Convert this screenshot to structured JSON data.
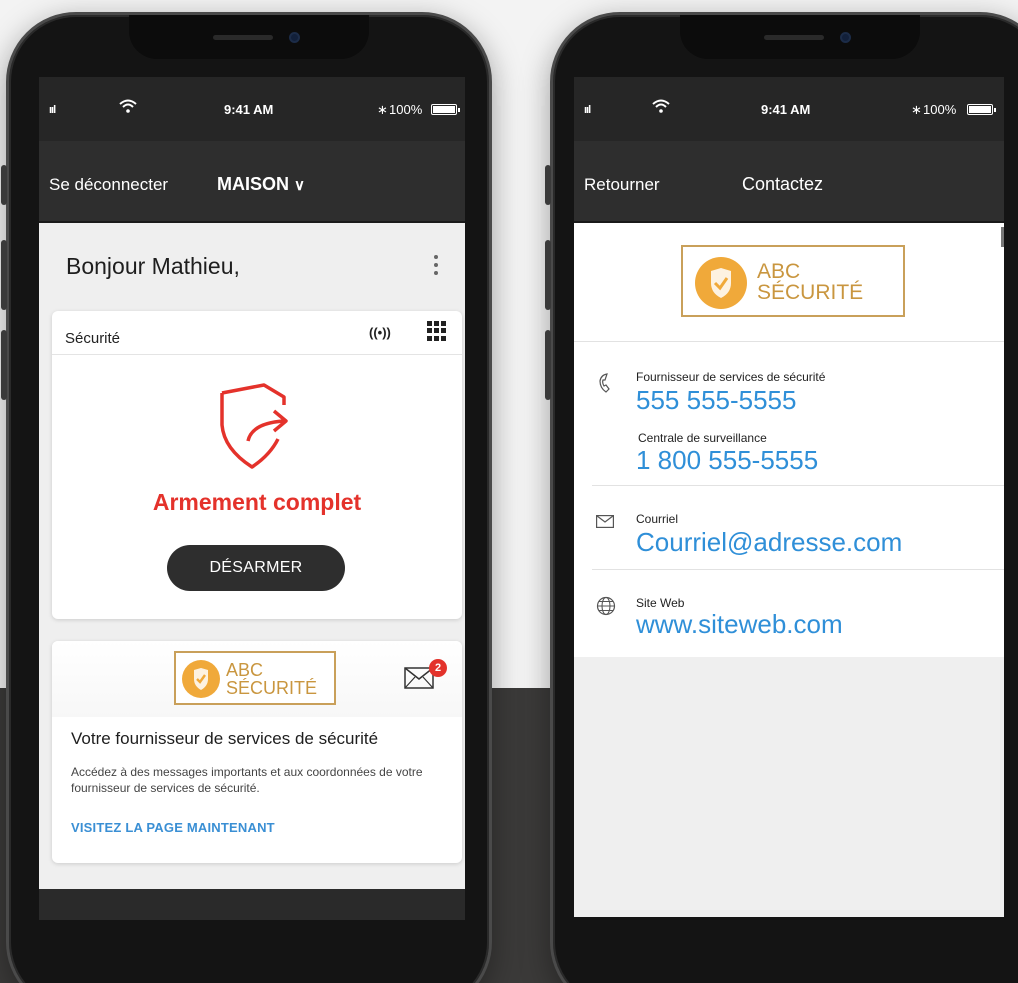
{
  "colors": {
    "accent_red": "#e4322b",
    "link_blue": "#2f8fd8",
    "logo_gold": "#c9a05a",
    "nav_dark": "#2e2e2e"
  },
  "left_phone": {
    "status": {
      "signal": "ııl",
      "wifi": "wifi-icon",
      "time": "9:41 AM",
      "bluetooth": "∗",
      "battery": "100%"
    },
    "nav": {
      "logout": "Se déconnecter",
      "location": "MAISON",
      "chevron": "∨"
    },
    "greeting": "Bonjour Mathieu,",
    "security_card": {
      "title": "Sécurité",
      "sensor_icon": "((•))",
      "status": "Armement complet",
      "disarm_label": "DÉSARMER"
    },
    "provider_card": {
      "logo_line1": "ABC",
      "logo_line2": "SÉCURITÉ",
      "unread_count": "2",
      "heading": "Votre fournisseur de services de sécurité",
      "description": "Accédez à des messages importants et aux coordonnées de votre fournisseur de services de sécurité.",
      "visit_link": "VISITEZ LA PAGE MAINTENANT"
    }
  },
  "right_phone": {
    "status": {
      "signal": "ııl",
      "wifi": "wifi-icon",
      "time": "9:41 AM",
      "bluetooth": "∗",
      "battery": "100%"
    },
    "nav": {
      "back": "Retourner",
      "title": "Contactez"
    },
    "logo_line1": "ABC",
    "logo_line2": "SÉCURITÉ",
    "contacts": {
      "provider_label": "Fournisseur de services de sécurité",
      "provider_phone": "555 555-5555",
      "monitoring_label": "Centrale de surveillance",
      "monitoring_phone": "1 800 555-5555",
      "email_label": "Courriel",
      "email_value": "Courriel@adresse.com",
      "website_label": "Site Web",
      "website_value": "www.siteweb.com"
    }
  }
}
